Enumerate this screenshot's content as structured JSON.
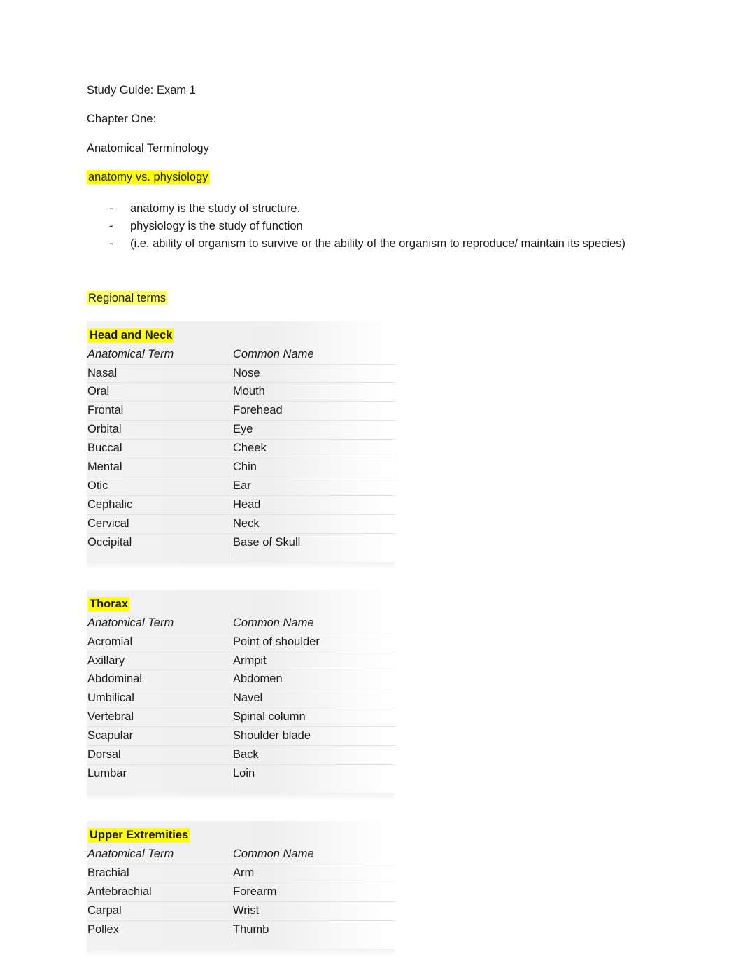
{
  "document": {
    "title_line": "Study Guide:  Exam 1",
    "chapter_line": "Chapter One:",
    "section_line": "Anatomical Terminology",
    "topic_heading": "anatomy vs. physiology",
    "bullets": [
      "anatomy is the study of structure.",
      "physiology is the study of function",
      "(i.e. ability of organism to survive or the ability of the organism to reproduce/ maintain its species)"
    ],
    "bullet_marker": "-",
    "regional_heading": "Regional terms",
    "tables": [
      {
        "title": "Head and Neck",
        "headers": [
          "Anatomical Term",
          "Common Name"
        ],
        "rows": [
          [
            "Nasal",
            "Nose"
          ],
          [
            "Oral",
            "Mouth"
          ],
          [
            "Frontal",
            "Forehead"
          ],
          [
            "Orbital",
            "Eye"
          ],
          [
            "Buccal",
            "Cheek"
          ],
          [
            "Mental",
            "Chin"
          ],
          [
            "Otic",
            "Ear"
          ],
          [
            "Cephalic",
            "Head"
          ],
          [
            "Cervical",
            "Neck"
          ],
          [
            "Occipital",
            "Base of Skull"
          ]
        ]
      },
      {
        "title": "Thorax",
        "headers": [
          "Anatomical Term",
          "Common Name"
        ],
        "rows": [
          [
            "Acromial",
            "Point of shoulder"
          ],
          [
            "Axillary",
            "Armpit"
          ],
          [
            "Abdominal",
            "Abdomen"
          ],
          [
            "Umbilical",
            "Navel"
          ],
          [
            "Vertebral",
            "Spinal column"
          ],
          [
            "Scapular",
            "Shoulder blade"
          ],
          [
            "Dorsal",
            "Back"
          ],
          [
            "Lumbar",
            "Loin"
          ]
        ]
      },
      {
        "title": "Upper Extremities",
        "headers": [
          "Anatomical Term",
          "Common Name"
        ],
        "rows": [
          [
            "Brachial",
            "Arm"
          ],
          [
            "Antebrachial",
            "Forearm"
          ],
          [
            "Carpal",
            "Wrist"
          ],
          [
            "Pollex",
            "Thumb"
          ]
        ]
      }
    ]
  },
  "colors": {
    "highlight": "#ffff00",
    "text": "#1a1a1a",
    "table_bg": "#f2f2f2"
  }
}
